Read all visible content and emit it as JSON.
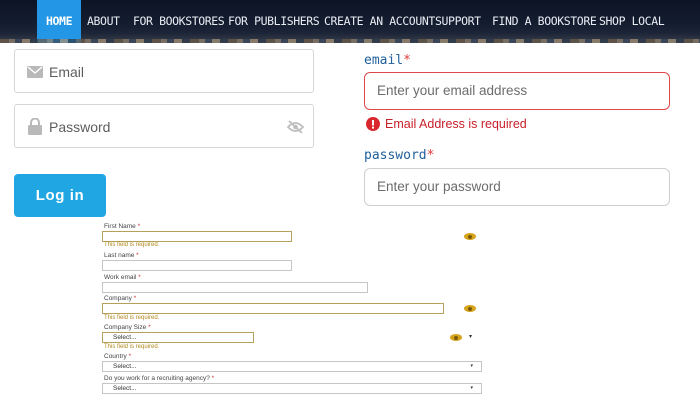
{
  "nav": {
    "items": [
      {
        "label": "HOME",
        "active": true
      },
      {
        "label": "ABOUT"
      },
      {
        "label": "FOR BOOKSTORES"
      },
      {
        "label": "FOR PUBLISHERS"
      },
      {
        "label": "CREATE AN ACCOUNT"
      },
      {
        "label": "SUPPORT"
      },
      {
        "label": "FIND A BOOKSTORE"
      },
      {
        "label": "SHOP LOCAL"
      }
    ]
  },
  "login": {
    "email_placeholder": "Email",
    "password_placeholder": "Password",
    "button_label": "Log in"
  },
  "signup": {
    "email_label": "email",
    "required_mark": "*",
    "email_placeholder": "Enter your email address",
    "email_error": "Email Address is required",
    "password_label": "password",
    "password_placeholder": "Enter your password"
  },
  "lead_form": {
    "required_mark": "*",
    "field_error": "This field is required.",
    "first_name_label": "First Name",
    "last_name_label": "Last name",
    "work_email_label": "Work email",
    "company_label": "Company",
    "company_size_label": "Company Size",
    "country_label": "Country",
    "recruiting_label": "Do you work for a recruiting agency?",
    "select_placeholder": "Select..."
  },
  "colors": {
    "accent": "#20a6e2",
    "nav_active": "#2396e6",
    "error": "#c8202a",
    "label_blue": "#1f5f9c"
  }
}
